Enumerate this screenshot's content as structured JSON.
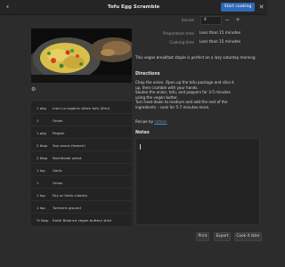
{
  "header": {
    "title": "Tofu Egg Scramble",
    "start_cooking": "Start cooking",
    "back_glyph": "‹",
    "close_glyph": "✕"
  },
  "fields": {
    "serves_label": "Serves",
    "serves_value": "4",
    "stepper_minus": "−",
    "stepper_plus": "+",
    "prep_label": "Preparation time",
    "prep_value": "Less than 15 minutes",
    "cook_label": "Cooking time",
    "cook_value": "Less than 15 minutes"
  },
  "description": "This vegan breakfast staple is perfect on a lazy saturday morning.",
  "directions": {
    "title": "Directions",
    "lines": [
      "Chop the onion. Open up the tofu package and slice it",
      "up, then crumble with your hands.",
      "Sautee the onion, tofu, and peppers for 3-5 minutes",
      "using the vegan butter.",
      "Turn heat down to medium and add the rest of the",
      "ingredients – cook for 5-7 minutes more."
    ]
  },
  "recipe_by": {
    "prefix": "Recipe by",
    "author": "luthien"
  },
  "notes": {
    "title": "Notes"
  },
  "ingredients": [
    {
      "amount": "1 pkg",
      "name": "mori-nu organic silken tofu (firm)"
    },
    {
      "amount": "1",
      "name": "Onion"
    },
    {
      "amount": "1 pkg",
      "name": "Pepper"
    },
    {
      "amount": "2 tbsp",
      "name": "Soy sauce (tamari)"
    },
    {
      "amount": "2 tbsp",
      "name": "Nutritional yeast"
    },
    {
      "amount": "1 tsp",
      "name": "Garlic"
    },
    {
      "amount": "1",
      "name": "Onion"
    },
    {
      "amount": "1 tsp",
      "name": "Dry or fresh cilantro"
    },
    {
      "amount": "1 tsp",
      "name": "Turmeric ground"
    },
    {
      "amount": "½ tbsp",
      "name": "Earth Balance vegan buttery stick"
    }
  ],
  "icons": {
    "gear": "⚙"
  },
  "footer": {
    "print": "Print",
    "export": "Export",
    "cook_it_later": "Cook it later"
  },
  "colors": {
    "accent": "#2f6bb6",
    "link": "#4a90d9",
    "background": "#2c2c2c"
  }
}
